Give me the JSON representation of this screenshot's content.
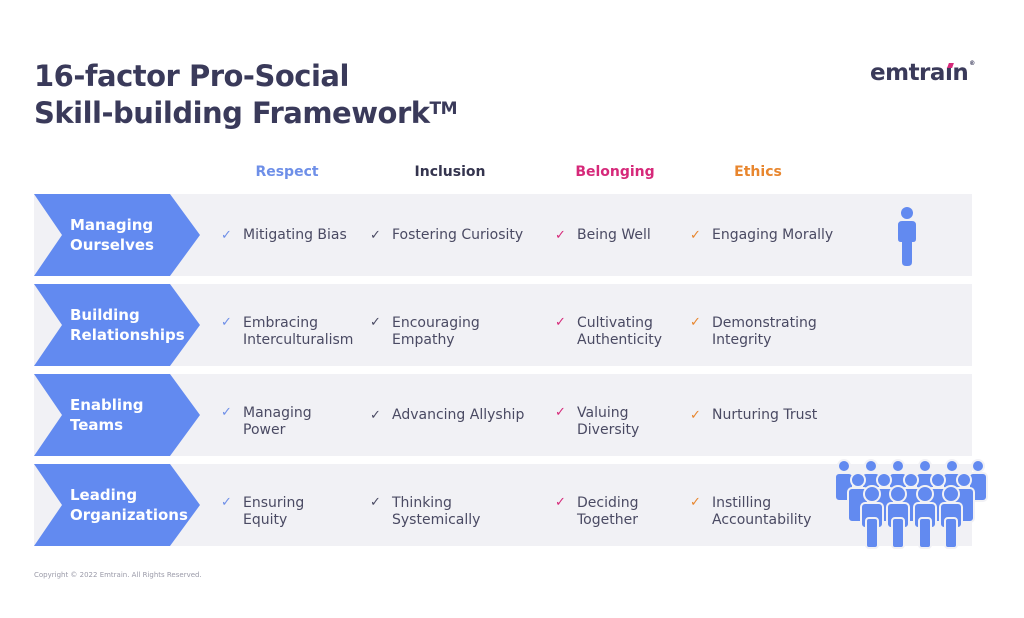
{
  "title": {
    "line1": "16-factor Pro-Social",
    "line2": "Skill-building Framework",
    "trademark": "TM"
  },
  "logo": {
    "text_before": "emtra",
    "text_i": "ı",
    "text_after": "n",
    "registered": "®",
    "accent_color": "#d6297a"
  },
  "columns": [
    {
      "label": "Respect",
      "color": "#6e8fe8",
      "check_color": "#6e8fe8"
    },
    {
      "label": "Inclusion",
      "color": "#34344e",
      "check_color": "#4a4a63"
    },
    {
      "label": "Belonging",
      "color": "#d6297a",
      "check_color": "#d6297a"
    },
    {
      "label": "Ethics",
      "color": "#e8862e",
      "check_color": "#e8862e"
    }
  ],
  "check_glyph": "✓",
  "rows": [
    {
      "label_line1": "Managing",
      "label_line2": "Ourselves",
      "cells": [
        [
          "Mitigating Bias"
        ],
        [
          "Fostering Curiosity"
        ],
        [
          "Being Well"
        ],
        [
          "Engaging Morally"
        ]
      ],
      "icon": "single-person-icon"
    },
    {
      "label_line1": "Building",
      "label_line2": "Relationships",
      "cells": [
        [
          "Embracing",
          "Interculturalism"
        ],
        [
          "Encouraging",
          "Empathy"
        ],
        [
          "Cultivating",
          "Authenticity"
        ],
        [
          "Demonstrating",
          "Integrity"
        ]
      ]
    },
    {
      "label_line1": "Enabling",
      "label_line2": "Teams",
      "cells": [
        [
          "Managing",
          "Power"
        ],
        [
          "Advancing Allyship"
        ],
        [
          "Valuing",
          "Diversity"
        ],
        [
          "Nurturing Trust"
        ]
      ]
    },
    {
      "label_line1": "Leading",
      "label_line2": "Organizations",
      "cells": [
        [
          "Ensuring",
          "Equity"
        ],
        [
          "Thinking",
          "Systemically"
        ],
        [
          "Deciding",
          "Together"
        ],
        [
          "Instilling",
          "Accountability"
        ]
      ],
      "icon": "crowd-icon"
    }
  ],
  "colors": {
    "chevron": "#628af0",
    "band": "#f1f1f5",
    "title": "#3a3a5a",
    "person": "#628af0"
  },
  "copyright": "Copyright © 2022 Emtrain. All Rights Reserved."
}
